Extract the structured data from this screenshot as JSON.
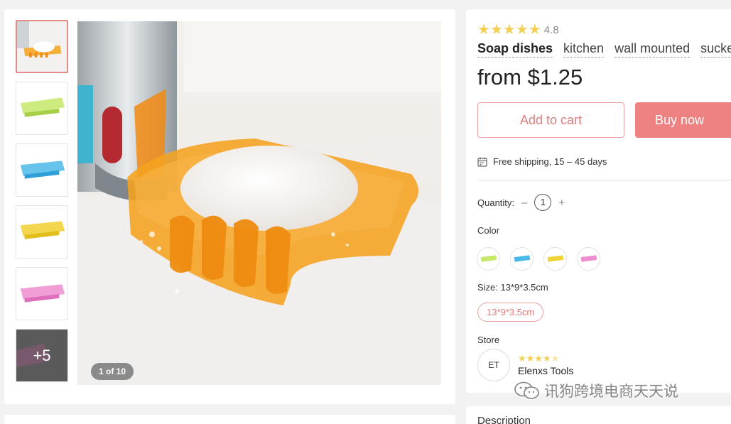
{
  "gallery": {
    "thumbnails": [
      {
        "color": "#f5a623",
        "name": "orange"
      },
      {
        "color": "#c6e86a",
        "name": "green"
      },
      {
        "color": "#4bb8e8",
        "name": "blue"
      },
      {
        "color": "#f2d23a",
        "name": "yellow"
      },
      {
        "color": "#ee8ccf",
        "name": "pink"
      }
    ],
    "more_label": "+5",
    "counter": "1 of 10"
  },
  "product": {
    "rating": "4.8",
    "stars": 5,
    "tags": [
      "Soap dishes",
      "kitchen",
      "wall mounted",
      "sucke"
    ],
    "price": "from $1.25",
    "add_to_cart": "Add to cart",
    "buy_now": "Buy now",
    "shipping": "Free shipping, 15 – 45 days",
    "quantity_label": "Quantity:",
    "quantity_minus": "–",
    "quantity_value": "1",
    "quantity_plus": "+",
    "color_label": "Color",
    "colors": [
      "#c6e86a",
      "#4bb8e8",
      "#f2d23a",
      "#ee8ccf"
    ],
    "size_label": "Size: 13*9*3.5cm",
    "size_option": "13*9*3.5cm",
    "store_label": "Store",
    "store_initials": "ET",
    "store_rating": 4.5,
    "store_name": "Elenxs Tools",
    "description_label": "Description"
  },
  "watermark": "讯狗跨境电商天天说",
  "colors": {
    "accent": "#ee8282",
    "star": "#f3cf54"
  }
}
